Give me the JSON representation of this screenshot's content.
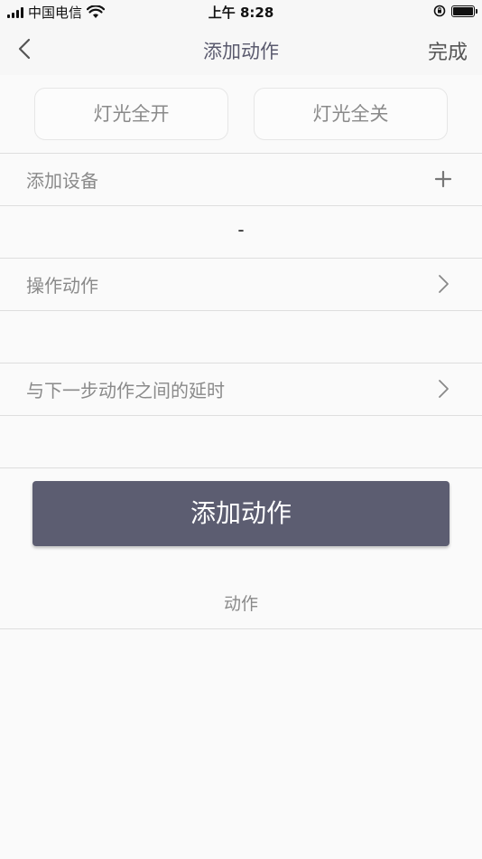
{
  "status_bar": {
    "carrier": "中国电信",
    "time": "上午 8:28"
  },
  "nav": {
    "title": "添加动作",
    "done_label": "完成"
  },
  "presets": {
    "all_on_label": "灯光全开",
    "all_off_label": "灯光全关"
  },
  "rows": {
    "add_device_label": "添加设备",
    "device_value": "-",
    "operation_label": "操作动作",
    "operation_value": "",
    "delay_label": "与下一步动作之间的延时",
    "delay_value": ""
  },
  "actions": {
    "add_action_label": "添加动作",
    "section_label": "动作"
  },
  "colors": {
    "primary_button": "#5c5d71",
    "nav_background": "#f7f7f7",
    "divider": "#dedede"
  },
  "icons": [
    "signal-icon",
    "wifi-icon",
    "lock-rotation-icon",
    "battery-icon",
    "back-chevron-icon",
    "plus-icon",
    "chevron-right-icon"
  ]
}
